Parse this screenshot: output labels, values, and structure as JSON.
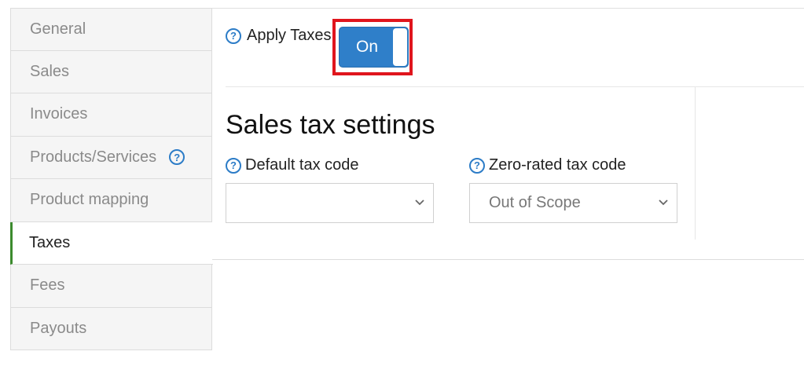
{
  "sidebar": {
    "items": [
      {
        "label": "General"
      },
      {
        "label": "Sales"
      },
      {
        "label": "Invoices"
      },
      {
        "label": "Products/Services"
      },
      {
        "label": "Product mapping"
      },
      {
        "label": "Taxes"
      },
      {
        "label": "Fees"
      },
      {
        "label": "Payouts"
      }
    ],
    "active": "Taxes"
  },
  "apply_taxes": {
    "label": "Apply Taxes",
    "toggle_text": "On",
    "enabled": true
  },
  "sales_tax": {
    "title": "Sales tax settings",
    "default_tax_code": {
      "label": "Default tax code",
      "value": ""
    },
    "zero_rated_tax_code": {
      "label": "Zero-rated tax code",
      "value": "Out of Scope"
    }
  },
  "icons": {
    "help": "question-circle-icon",
    "dropdown": "chevron-down-icon"
  },
  "colors": {
    "accent": "#2f7fc9",
    "active_border": "#3c8a2e",
    "highlight": "#e0151d"
  }
}
